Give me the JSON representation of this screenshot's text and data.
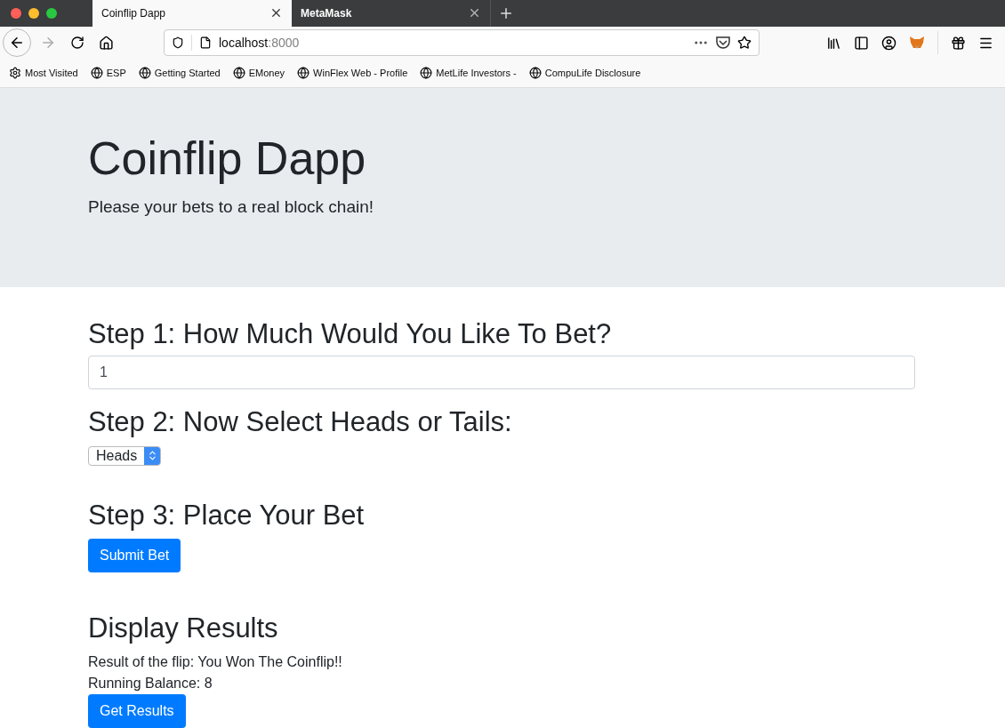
{
  "browser": {
    "tabs": [
      {
        "title": "Coinflip Dapp",
        "selected": true
      },
      {
        "title": "MetaMask",
        "selected": false
      }
    ],
    "address": {
      "host": "localhost",
      "port": ":8000"
    },
    "bookmarks": [
      {
        "kind": "gear",
        "label": "Most Visited"
      },
      {
        "kind": "globe",
        "label": "ESP"
      },
      {
        "kind": "globe",
        "label": "Getting Started"
      },
      {
        "kind": "globe",
        "label": "EMoney"
      },
      {
        "kind": "globe",
        "label": "WinFlex Web - Profile"
      },
      {
        "kind": "globe",
        "label": "MetLife Investors -"
      },
      {
        "kind": "globe",
        "label": "CompuLife Disclosure"
      }
    ]
  },
  "hero": {
    "title": "Coinflip Dapp",
    "subtitle": "Please your bets to a real block chain!"
  },
  "step1": {
    "heading": "Step 1: How Much Would You Like To Bet?",
    "value": "1"
  },
  "step2": {
    "heading": "Step 2: Now Select Heads or Tails:",
    "choice": "Heads"
  },
  "step3": {
    "heading": "Step 3: Place Your Bet",
    "button": "Submit Bet"
  },
  "results": {
    "heading": "Display Results",
    "lines": [
      "Result of the flip: You Won The Coinflip!!",
      "Running Balance: 8"
    ],
    "button": "Get Results"
  }
}
